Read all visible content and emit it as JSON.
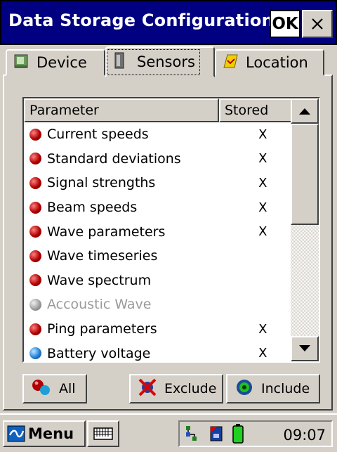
{
  "window": {
    "title": "Data Storage Configurations",
    "ok_label": "OK",
    "close_symbol": "×"
  },
  "tabs": [
    {
      "label": "Device",
      "icon": "device-icon",
      "active": false
    },
    {
      "label": "Sensors",
      "icon": "sensors-icon",
      "active": true
    },
    {
      "label": "Location",
      "icon": "location-icon",
      "active": false
    }
  ],
  "list": {
    "columns": [
      "Parameter",
      "Stored"
    ],
    "rows": [
      {
        "label": "Current speeds",
        "stored": "X",
        "status": "red",
        "enabled": true
      },
      {
        "label": "Standard deviations",
        "stored": "X",
        "status": "red",
        "enabled": true
      },
      {
        "label": "Signal strengths",
        "stored": "X",
        "status": "red",
        "enabled": true
      },
      {
        "label": "Beam speeds",
        "stored": "X",
        "status": "red",
        "enabled": true
      },
      {
        "label": "Wave parameters",
        "stored": "X",
        "status": "red",
        "enabled": true
      },
      {
        "label": "Wave timeseries",
        "stored": "",
        "status": "red",
        "enabled": true
      },
      {
        "label": "Wave spectrum",
        "stored": "",
        "status": "red",
        "enabled": true
      },
      {
        "label": "Accoustic Wave",
        "stored": "",
        "status": "gray",
        "enabled": false
      },
      {
        "label": "Ping parameters",
        "stored": "X",
        "status": "red",
        "enabled": true
      },
      {
        "label": "Battery voltage",
        "stored": "X",
        "status": "blue",
        "enabled": true
      }
    ]
  },
  "buttons": {
    "all": "All",
    "exclude": "Exclude",
    "include": "Include"
  },
  "taskbar": {
    "start_label": "Menu",
    "clock": "09:07"
  },
  "colors": {
    "titlebar": "#000080",
    "dot_red": "#b00000",
    "dot_gray": "#a0a0a0",
    "dot_blue": "#1f7fd8"
  }
}
